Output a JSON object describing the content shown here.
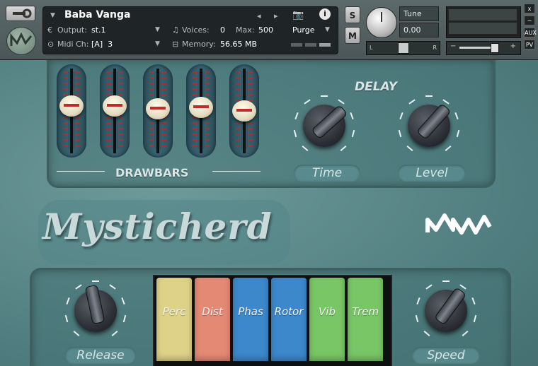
{
  "header": {
    "instrument_name": "Baba Vanga",
    "output_label": "Output:",
    "output_value": "st.1",
    "voices_label": "Voices:",
    "voices_value": "0",
    "max_label": "Max:",
    "max_value": "500",
    "purge_label": "Purge",
    "midi_label": "Midi Ch:",
    "midi_value": "[A]  3",
    "memory_label": "Memory:",
    "memory_value": "56.65 MB",
    "solo_label": "S",
    "mute_label": "M",
    "tune_label": "Tune",
    "tune_value": "0.00",
    "pan_left": "L",
    "pan_right": "R",
    "vol_minus": "−",
    "vol_plus": "+",
    "side_buttons": [
      "x",
      "−",
      "AUX",
      "PV"
    ]
  },
  "drawbars": {
    "label": "DRAWBARS",
    "levels": [
      0.62,
      0.62,
      0.58,
      0.6,
      0.55
    ]
  },
  "delay": {
    "label": "DELAY",
    "time_label": "Time",
    "level_label": "Level"
  },
  "title": "Mysticherd",
  "bottom": {
    "release_label": "Release",
    "speed_label": "Speed",
    "switches": [
      {
        "label": "Perc",
        "color": "#e9dd8f"
      },
      {
        "label": "Dist",
        "color": "#f0907a"
      },
      {
        "label": "Phas",
        "color": "#3f8fd6"
      },
      {
        "label": "Rotor",
        "color": "#3f8fd6"
      },
      {
        "label": "Vib",
        "color": "#7fd06b"
      },
      {
        "label": "Trem",
        "color": "#7fd06b"
      }
    ]
  }
}
